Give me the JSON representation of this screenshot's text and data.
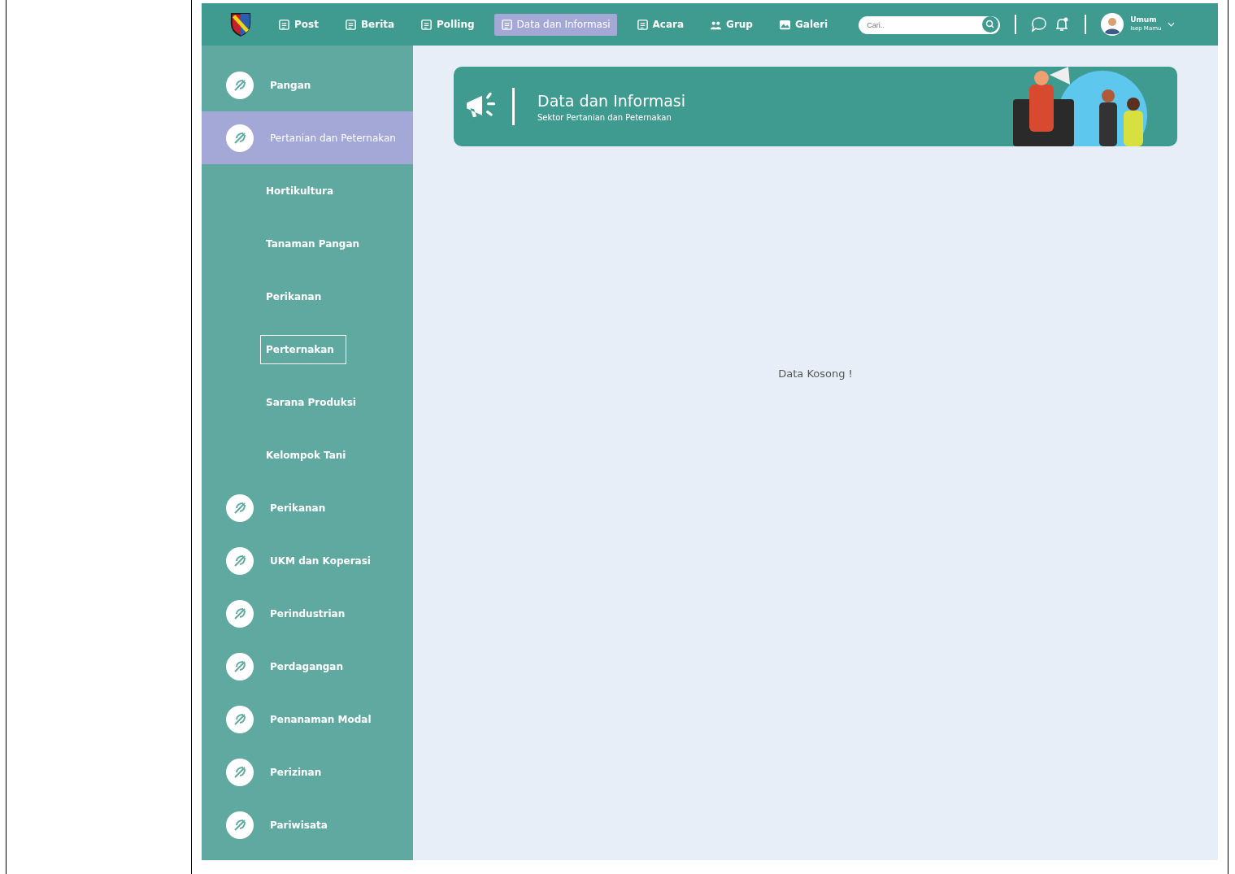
{
  "navbar": {
    "items": [
      {
        "label": "Post",
        "selected": false
      },
      {
        "label": "Berita",
        "selected": false
      },
      {
        "label": "Polling",
        "selected": false
      },
      {
        "label": "Data dan Informasi",
        "selected": true
      },
      {
        "label": "Acara",
        "selected": false
      },
      {
        "label": "Grup",
        "selected": false
      },
      {
        "label": "Galeri",
        "selected": false
      }
    ],
    "search": {
      "placeholder": "Cari.."
    },
    "user": {
      "name": "Umum",
      "subtitle": "Isep Mamu"
    }
  },
  "sidebar": {
    "items": [
      {
        "label": "Pangan",
        "selected": false
      },
      {
        "label": "Pertanian dan Peternakan",
        "selected": true,
        "expanded": true,
        "children": [
          {
            "label": "Hortikultura",
            "selected": false
          },
          {
            "label": "Tanaman Pangan",
            "selected": false
          },
          {
            "label": "Perikanan",
            "selected": false
          },
          {
            "label": "Perternakan",
            "selected": true
          },
          {
            "label": "Sarana Produksi",
            "selected": false
          },
          {
            "label": "Kelompok Tani",
            "selected": false
          }
        ]
      },
      {
        "label": "Perikanan",
        "selected": false
      },
      {
        "label": "UKM dan Koperasi",
        "selected": false
      },
      {
        "label": "Perindustrian",
        "selected": false
      },
      {
        "label": "Perdagangan",
        "selected": false
      },
      {
        "label": "Penanaman Modal",
        "selected": false
      },
      {
        "label": "Perizinan",
        "selected": false
      },
      {
        "label": "Pariwisata",
        "selected": false
      }
    ]
  },
  "banner": {
    "title": "Data dan Informasi",
    "subtitle": "Sektor Pertanian dan Peternakan"
  },
  "empty_message": "Data Kosong !"
}
